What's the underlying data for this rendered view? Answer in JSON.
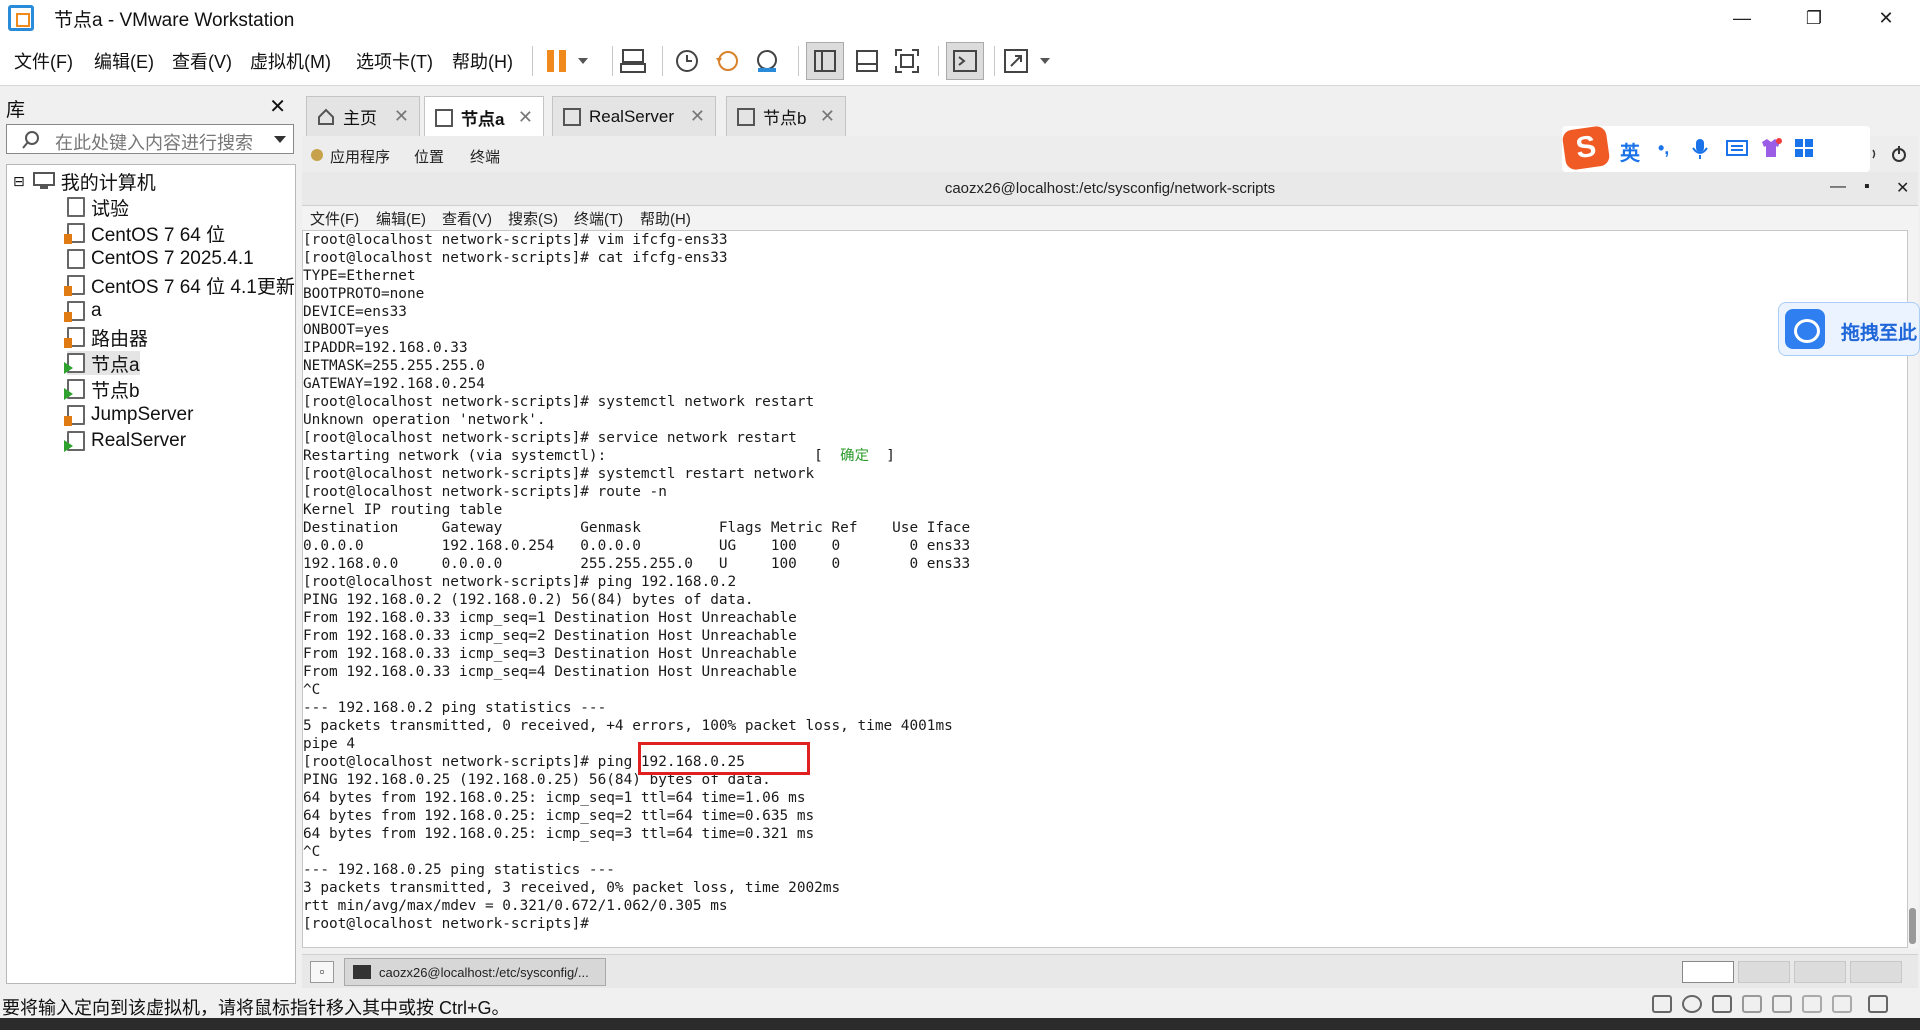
{
  "window": {
    "title": "节点a - VMware Workstation",
    "controls": [
      "—",
      "❐",
      "✕"
    ]
  },
  "menubar": {
    "items": [
      "文件(F)",
      "编辑(E)",
      "查看(V)",
      "虚拟机(M)",
      "选项卡(T)",
      "帮助(H)"
    ]
  },
  "library": {
    "title": "库",
    "close": "✕",
    "search_placeholder": "在此处键入内容进行搜索",
    "root": "我的计算机",
    "expander": "⊟",
    "items": [
      "试验",
      "CentOS 7 64 位",
      "CentOS 7 2025.4.1",
      "CentOS 7 64 位 4.1更新",
      "a",
      "路由器",
      "节点a",
      "节点b",
      "JumpServer",
      "RealServer"
    ]
  },
  "tabs": [
    {
      "label": "主页",
      "close": "✕"
    },
    {
      "label": "节点a",
      "close": "✕"
    },
    {
      "label": "RealServer",
      "close": "✕"
    },
    {
      "label": "节点b",
      "close": "✕"
    }
  ],
  "guest_panel": {
    "items": [
      "应用程序",
      "位置",
      "终端"
    ]
  },
  "terminal_window": {
    "title": "caozx26@localhost:/etc/sysconfig/network-scripts",
    "controls": [
      "—",
      "▪",
      "✕"
    ],
    "menu": [
      "文件(F)",
      "编辑(E)",
      "查看(V)",
      "搜索(S)",
      "终端(T)",
      "帮助(H)"
    ]
  },
  "terminal": {
    "lines": [
      "[root@localhost network-scripts]# vim ifcfg-ens33",
      "[root@localhost network-scripts]# cat ifcfg-ens33",
      "TYPE=Ethernet",
      "BOOTPROTO=none",
      "DEVICE=ens33",
      "ONBOOT=yes",
      "IPADDR=192.168.0.33",
      "NETMASK=255.255.255.0",
      "GATEWAY=192.168.0.254",
      "[root@localhost network-scripts]# systemctl network restart",
      "Unknown operation 'network'.",
      "[root@localhost network-scripts]# service network restart",
      "Restarting network (via systemctl):                        [  ",
      "[root@localhost network-scripts]# systemctl restart network",
      "[root@localhost network-scripts]# route -n",
      "Kernel IP routing table",
      "Destination     Gateway         Genmask         Flags Metric Ref    Use Iface",
      "0.0.0.0         192.168.0.254   0.0.0.0         UG    100    0        0 ens33",
      "192.168.0.0     0.0.0.0         255.255.255.0   U     100    0        0 ens33",
      "[root@localhost network-scripts]# ping 192.168.0.2",
      "PING 192.168.0.2 (192.168.0.2) 56(84) bytes of data.",
      "From 192.168.0.33 icmp_seq=1 Destination Host Unreachable",
      "From 192.168.0.33 icmp_seq=2 Destination Host Unreachable",
      "From 192.168.0.33 icmp_seq=3 Destination Host Unreachable",
      "From 192.168.0.33 icmp_seq=4 Destination Host Unreachable",
      "^C",
      "--- 192.168.0.2 ping statistics ---",
      "5 packets transmitted, 0 received, +4 errors, 100% packet loss, time 4001ms",
      "pipe 4",
      "[root@localhost network-scripts]# ping 192.168.0.25",
      "PING 192.168.0.25 (192.168.0.25) 56(84) bytes of data.",
      "64 bytes from 192.168.0.25: icmp_seq=1 ttl=64 time=1.06 ms",
      "64 bytes from 192.168.0.25: icmp_seq=2 ttl=64 time=0.635 ms",
      "64 bytes from 192.168.0.25: icmp_seq=3 ttl=64 time=0.321 ms",
      "^C",
      "--- 192.168.0.25 ping statistics ---",
      "3 packets transmitted, 3 received, 0% packet loss, time 2002ms",
      "rtt min/avg/max/mdev = 0.321/0.672/1.062/0.305 ms",
      "[root@localhost network-scripts]# "
    ],
    "ok_status": "确定",
    "ok_close": "]"
  },
  "guest_taskbar": {
    "task_label": "caozx26@localhost:/etc/sysconfig/..."
  },
  "statusbar": {
    "text": "要将输入定向到该虚拟机，请将鼠标指针移入其中或按 Ctrl+G。"
  },
  "ime": {
    "logo": "S",
    "lang": "英",
    "punct": "•,"
  },
  "drag_popup": {
    "text": "拖拽至此"
  },
  "colors": {
    "highlight": "#e02020",
    "accent": "#1a73e8",
    "ok_green": "#2a9a2a"
  }
}
